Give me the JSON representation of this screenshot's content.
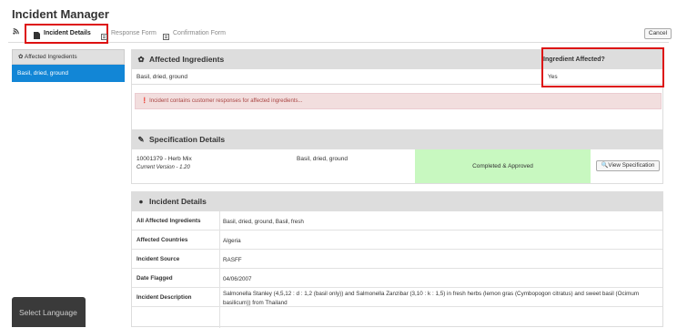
{
  "app": {
    "title": "Incident Manager"
  },
  "tabs": [
    {
      "label": "Incident Details",
      "icon": "document-icon"
    },
    {
      "label": "Response Form",
      "icon": "form-icon"
    },
    {
      "label": "Confirmation Form",
      "icon": "form-icon"
    }
  ],
  "actions": {
    "cancel": "Cancel"
  },
  "sidebar": {
    "header": "Affected Ingredients",
    "items": [
      {
        "label": "Basil, dried, ground"
      }
    ]
  },
  "language": {
    "label": "Select Language"
  },
  "affected": {
    "title": "Affected Ingredients",
    "col_header": "Ingredient Affected?",
    "row": {
      "name": "Basil, dried, ground",
      "value": "Yes"
    },
    "alert": "Incident contains customer responses for affected ingredients..."
  },
  "spec": {
    "title": "Specification Details",
    "code": "10001379 - Herb Mix",
    "version": "Current Version - 1.20",
    "ingredient": "Basil, dried, ground",
    "status": "Completed & Approved",
    "status_color": "#c8f8c0",
    "view_label": "View Specification"
  },
  "details": {
    "title": "Incident Details",
    "rows": [
      {
        "key": "All Affected Ingredients",
        "value": "Basil, dried, ground, Basil, fresh"
      },
      {
        "key": "Affected Countries",
        "value": "Algeria"
      },
      {
        "key": "Incident Source",
        "value": "RASFF"
      },
      {
        "key": "Date Flagged",
        "value": "04/06/2007"
      },
      {
        "key": "Incident Description",
        "value": "Salmonella Stanley (4,5,12 : d : 1,2 (basil only)) and Salmonella Zanzibar (3,10 : k : 1,5) in fresh herbs (lemon gras (Cymbopogon citratus) and sweet basil (Ocimum basilicum)) from Thailand"
      }
    ]
  }
}
